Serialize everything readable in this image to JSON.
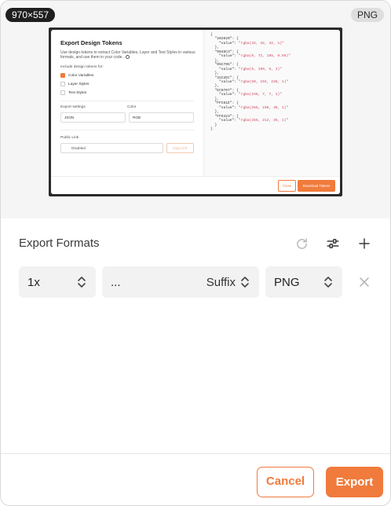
{
  "preview": {
    "dimensions": "970×557",
    "format_badge": "PNG",
    "modal": {
      "title": "Export Design Tokens",
      "description": "Use design tokens to extract Color Variables, Layer and Text Styles in various formats, and use them in your code.",
      "include_label": "Include design tokens for:",
      "options": [
        {
          "label": "Color Variables",
          "checked": true
        },
        {
          "label": "Layer Styles",
          "checked": false
        },
        {
          "label": "Text Styles",
          "checked": false
        }
      ],
      "export_settings_label": "Export settings",
      "color_label": "Color",
      "export_settings_value": "JSON",
      "color_value": "RGB",
      "public_link_label": "Public Link",
      "public_link_value": "Disabled",
      "copy_link": "Copy Link",
      "close": "Close",
      "download": "Download Tokens",
      "code_lines": [
        {
          "t": "{"
        },
        {
          "t": "  \"202020\": {"
        },
        {
          "t": "    \"value\": ",
          "s": "\"rgba(32, 32, 32, 1)\""
        },
        {
          "t": "  },"
        },
        {
          "t": "  \"0048C3\": {"
        },
        {
          "t": "    \"value\": ",
          "s": "\"rgba(0, 72, 195, 0.85)\""
        },
        {
          "t": "  },"
        },
        {
          "t": "  \"05C705\": {"
        },
        {
          "t": "    \"value\": ",
          "s": "\"rgba(5, 199, 5, 1)\""
        },
        {
          "t": "  },"
        },
        {
          "t": "  \"32C2EC\": {"
        },
        {
          "t": "    \"value\": ",
          "s": "\"rgba(50, 194, 236, 1)\""
        },
        {
          "t": "  },"
        },
        {
          "t": "  \"EC0707\": {"
        },
        {
          "t": "    \"value\": ",
          "s": "\"rgba(236, 7, 7, 1)\""
        },
        {
          "t": "  },"
        },
        {
          "t": "  \"FFC61E\": {"
        },
        {
          "t": "    \"value\": ",
          "s": "\"rgba(255, 198, 30, 1)\""
        },
        {
          "t": "  },"
        },
        {
          "t": "  \"FFD423\": {"
        },
        {
          "t": "    \"value\": ",
          "s": "\"rgba(255, 212, 35, 1)\""
        },
        {
          "t": "  }"
        },
        {
          "t": "}"
        }
      ]
    }
  },
  "export_formats": {
    "title": "Export Formats",
    "scale_value": "1x",
    "prefix_value": "...",
    "suffix_label": "Suffix",
    "format_value": "PNG"
  },
  "footer": {
    "cancel": "Cancel",
    "export": "Export"
  },
  "colors": {
    "accent": "#f07b3c",
    "field_bg": "#f2f2f2",
    "preview_bg": "#f5f5f5"
  }
}
